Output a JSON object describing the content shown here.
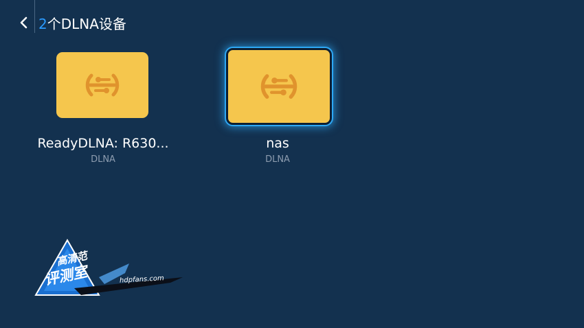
{
  "header": {
    "back_icon": "chevron-left-icon",
    "count": "2",
    "title_text": "个DLNA设备"
  },
  "devices": [
    {
      "name": "ReadyDLNA: R630...",
      "type": "DLNA",
      "icon": "dlna-link-icon",
      "focused": false
    },
    {
      "name": "nas",
      "type": "DLNA",
      "icon": "dlna-link-icon",
      "focused": true
    }
  ],
  "watermark": {
    "line1": "高清范",
    "line2": "评测室",
    "url": "hdpfans.com"
  },
  "colors": {
    "background": "#13314f",
    "accent": "#2b9bff",
    "card": "#f5c64d",
    "icon": "#e0932d",
    "focus_ring": "#2ea8f5",
    "subtext": "#8d9caf"
  }
}
